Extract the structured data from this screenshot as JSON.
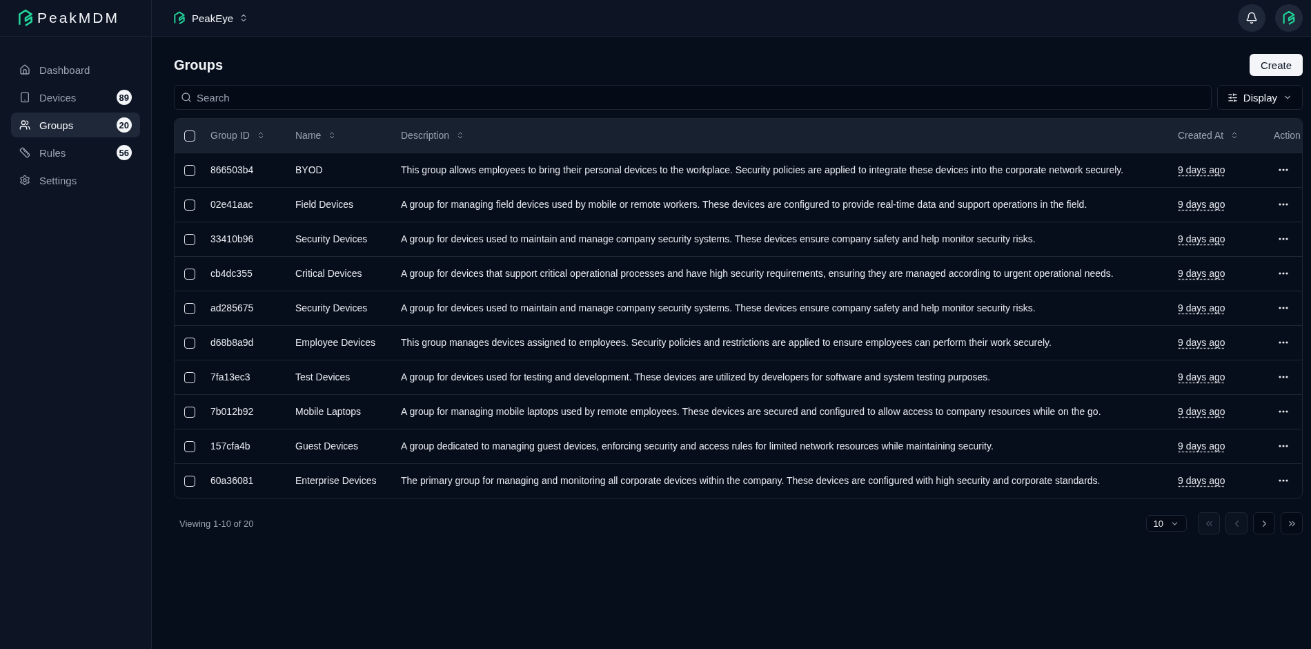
{
  "brand": {
    "name": "PeakMDM"
  },
  "workspace": {
    "name": "PeakEye"
  },
  "sidebar": {
    "items": [
      {
        "kind": "dashboard",
        "label": "Dashboard",
        "selected": false
      },
      {
        "kind": "devices",
        "label": "Devices",
        "count": "89",
        "selected": false
      },
      {
        "kind": "groups",
        "label": "Groups",
        "count": "20",
        "selected": true
      },
      {
        "kind": "rules",
        "label": "Rules",
        "count": "56",
        "selected": false
      },
      {
        "kind": "settings",
        "label": "Settings",
        "selected": false
      }
    ]
  },
  "page": {
    "title": "Groups",
    "create_button": "Create",
    "search": {
      "placeholder": "Search"
    },
    "display_button": "Display"
  },
  "table": {
    "select_all_checked": false,
    "columns": [
      {
        "label": "Group ID",
        "kind": "sortable"
      },
      {
        "label": "Name",
        "kind": "sortable"
      },
      {
        "label": "Description",
        "kind": "sortable"
      },
      {
        "label": "Created At",
        "kind": "sortable"
      },
      {
        "label": "Action",
        "kind": "plain"
      }
    ],
    "rows": [
      {
        "id": "866503b4",
        "name": "BYOD",
        "description": "This group allows employees to bring their personal devices to the workplace. Security policies are applied to integrate these devices into the corporate network securely.",
        "created": "9 days ago",
        "checked": false
      },
      {
        "id": "02e41aac",
        "name": "Field Devices",
        "description": "A group for managing field devices used by mobile or remote workers. These devices are configured to provide real-time data and support operations in the field.",
        "created": "9 days ago",
        "checked": false
      },
      {
        "id": "33410b96",
        "name": "Security Devices",
        "description": "A group for devices used to maintain and manage company security systems. These devices ensure company safety and help monitor security risks.",
        "created": "9 days ago",
        "checked": false
      },
      {
        "id": "cb4dc355",
        "name": "Critical Devices",
        "description": "A group for devices that support critical operational processes and have high security requirements, ensuring they are managed according to urgent operational needs.",
        "created": "9 days ago",
        "checked": false
      },
      {
        "id": "ad285675",
        "name": "Security Devices",
        "description": "A group for devices used to maintain and manage company security systems. These devices ensure company safety and help monitor security risks.",
        "created": "9 days ago",
        "checked": false
      },
      {
        "id": "d68b8a9d",
        "name": "Employee Devices",
        "description": "This group manages devices assigned to employees. Security policies and restrictions are applied to ensure employees can perform their work securely.",
        "created": "9 days ago",
        "checked": false
      },
      {
        "id": "7fa13ec3",
        "name": "Test Devices",
        "description": "A group for devices used for testing and development. These devices are utilized by developers for software and system testing purposes.",
        "created": "9 days ago",
        "checked": false
      },
      {
        "id": "7b012b92",
        "name": "Mobile Laptops",
        "description": "A group for managing mobile laptops used by remote employees. These devices are secured and configured to allow access to company resources while on the go.",
        "created": "9 days ago",
        "checked": false
      },
      {
        "id": "157cfa4b",
        "name": "Guest Devices",
        "description": "A group dedicated to managing guest devices, enforcing security and access rules for limited network resources while maintaining security.",
        "created": "9 days ago",
        "checked": false
      },
      {
        "id": "60a36081",
        "name": "Enterprise Devices",
        "description": "The primary group for managing and monitoring all corporate devices within the company. These devices are configured with high security and corporate standards.",
        "created": "9 days ago",
        "checked": false
      }
    ]
  },
  "footer": {
    "summary": "Viewing 1-10 of 20",
    "page_size": "10",
    "pager": [
      {
        "kind": "first",
        "disabled": true
      },
      {
        "kind": "prev",
        "disabled": true
      },
      {
        "kind": "next",
        "disabled": false
      },
      {
        "kind": "last",
        "disabled": false
      }
    ]
  }
}
